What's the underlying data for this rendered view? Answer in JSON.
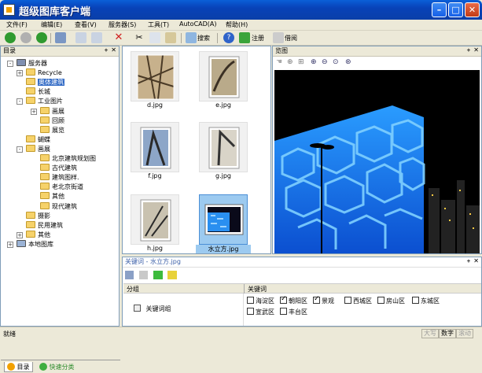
{
  "app": {
    "title": "超级图库客户端"
  },
  "menu": [
    "文件(F)",
    "编辑(E)",
    "查看(V)",
    "服务器(S)",
    "工具(T)",
    "AutoCAD(A)",
    "帮助(H)"
  ],
  "toolbar": {
    "search_label": "搜索",
    "register_label": "注册",
    "cancel_label": "借阅"
  },
  "left_panel": {
    "title": "目录",
    "tree": [
      {
        "label": "服务器",
        "depth": 0,
        "expander": "-"
      },
      {
        "label": "Recycle",
        "depth": 1,
        "expander": "+"
      },
      {
        "label": "奥体建筑",
        "depth": 1,
        "expander": "",
        "selected": true
      },
      {
        "label": "长城",
        "depth": 1,
        "expander": ""
      },
      {
        "label": "工业图片",
        "depth": 1,
        "expander": "-"
      },
      {
        "label": "画展",
        "depth": 2,
        "expander": "+"
      },
      {
        "label": "回顾",
        "depth": 2,
        "expander": ""
      },
      {
        "label": "展览",
        "depth": 2,
        "expander": ""
      },
      {
        "label": "蝴蝶",
        "depth": 1,
        "expander": ""
      },
      {
        "label": "画展",
        "depth": 1,
        "expander": "-"
      },
      {
        "label": "北京建筑规划图",
        "depth": 2,
        "expander": ""
      },
      {
        "label": "古代建筑",
        "depth": 2,
        "expander": ""
      },
      {
        "label": "建筑图样.",
        "depth": 2,
        "expander": ""
      },
      {
        "label": "老北京街道",
        "depth": 2,
        "expander": ""
      },
      {
        "label": "其他",
        "depth": 2,
        "expander": ""
      },
      {
        "label": "现代建筑",
        "depth": 2,
        "expander": ""
      },
      {
        "label": "摄影",
        "depth": 1,
        "expander": ""
      },
      {
        "label": "民用建筑",
        "depth": 1,
        "expander": ""
      },
      {
        "label": "其他",
        "depth": 1,
        "expander": "+"
      },
      {
        "label": "本地图库",
        "depth": 0,
        "expander": "+"
      }
    ],
    "tabs": [
      "目录",
      "快速分类"
    ]
  },
  "thumbnails": [
    {
      "caption": "d.jpg"
    },
    {
      "caption": "e.jpg"
    },
    {
      "caption": "f.jpg"
    },
    {
      "caption": "g.jpg"
    },
    {
      "caption": "h.jpg"
    },
    {
      "caption": "水立方.jpg",
      "selected": true
    }
  ],
  "preview": {
    "title": "览图"
  },
  "keyword_panel": {
    "title": "关键词 - 水立方.jpg",
    "col_group": "分组",
    "col_keywords": "关键词",
    "group_name": "关键词组",
    "keywords": [
      {
        "label": "海淀区",
        "checked": false
      },
      {
        "label": "朝阳区",
        "checked": true
      },
      {
        "label": "景观",
        "checked": true
      },
      {
        "label": "西城区",
        "checked": false
      },
      {
        "label": "房山区",
        "checked": false
      },
      {
        "label": "东城区",
        "checked": false
      },
      {
        "label": "宣武区",
        "checked": false
      },
      {
        "label": "丰台区",
        "checked": false
      }
    ]
  },
  "status": {
    "text": "就绪",
    "caps": "大写",
    "num": "数字",
    "scroll": "滚动"
  }
}
